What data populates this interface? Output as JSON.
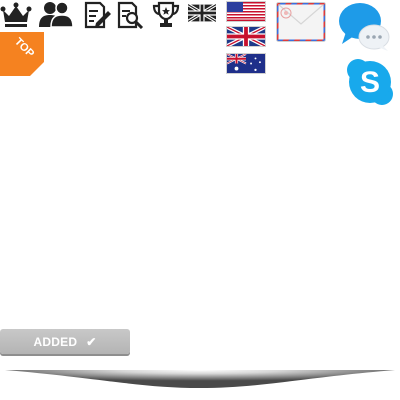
{
  "toolbar": {
    "icons": [
      "crown-icon",
      "users-icon",
      "edit-document-icon",
      "search-document-icon",
      "trophy-icon",
      "uk-flag-icon"
    ]
  },
  "badge": {
    "top_label": "TOP"
  },
  "flags": [
    "us-flag-icon",
    "uk-flag-icon",
    "australia-flag-icon"
  ],
  "contact": {
    "mail_icon": "envelope-icon",
    "chat_icon": "chat-bubble-icon",
    "skype_icon": "skype-icon"
  },
  "cart": {
    "added_label": "ADDED",
    "check_glyph": "✔"
  },
  "colors": {
    "badge": "#f58220",
    "chat": "#1e9be8",
    "skype": "#18a9ec",
    "button": "#bfbfbf"
  }
}
